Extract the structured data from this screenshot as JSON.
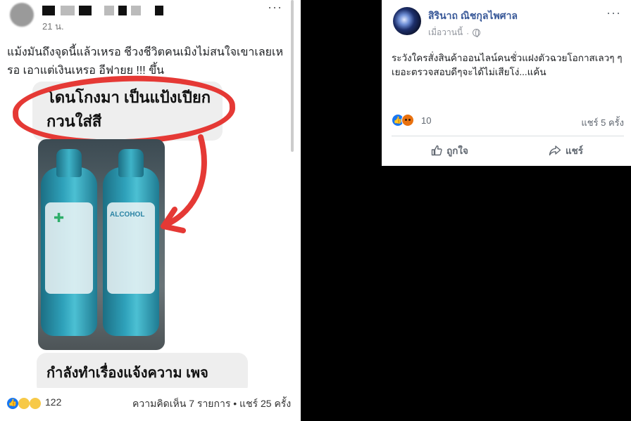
{
  "left_post": {
    "time": "21 น.",
    "more": "···",
    "caption": "แม้งมันถึงจุดนี้แล้วเหรอ ชีวงชีวิตคนเมิงไม่สนใจเขาเลยเหรอ เอาแต่เงินเหรอ อีฟายย !!! ขึ้น",
    "bubble_top": "โดนโกงมา เป็นแป้งเปียก กวนใส่สี",
    "bottle_label": "ALCOHOL",
    "bubble_bottom": "กำลังทำเรื่องแจ้งความ เพจ",
    "reaction_count": "122",
    "stats": "ความคิดเห็น 7 รายการ • แชร์ 25 ครั้ง"
  },
  "right_post": {
    "author": "สิรินาถ ณิชกุลไพศาล",
    "time": "เมื่อวานนี้",
    "more": "···",
    "text": "ระวังใครสั่งสินค้าออนไลน์คนชั่วแฝงตัวฉวยโอกาสเลวๆ ๆเยอะตรวจสอบดีๆจะได้ไม่เสียโง่...แค้น",
    "reaction_count": "10",
    "share_count": "แชร์ 5 ครั้ง",
    "like_label": "ถูกใจ",
    "share_label": "แชร์"
  },
  "colors": {
    "link_blue": "#385898",
    "like_blue": "#1877f2",
    "angry_orange": "#e9710f",
    "ring_red": "#e53935"
  }
}
